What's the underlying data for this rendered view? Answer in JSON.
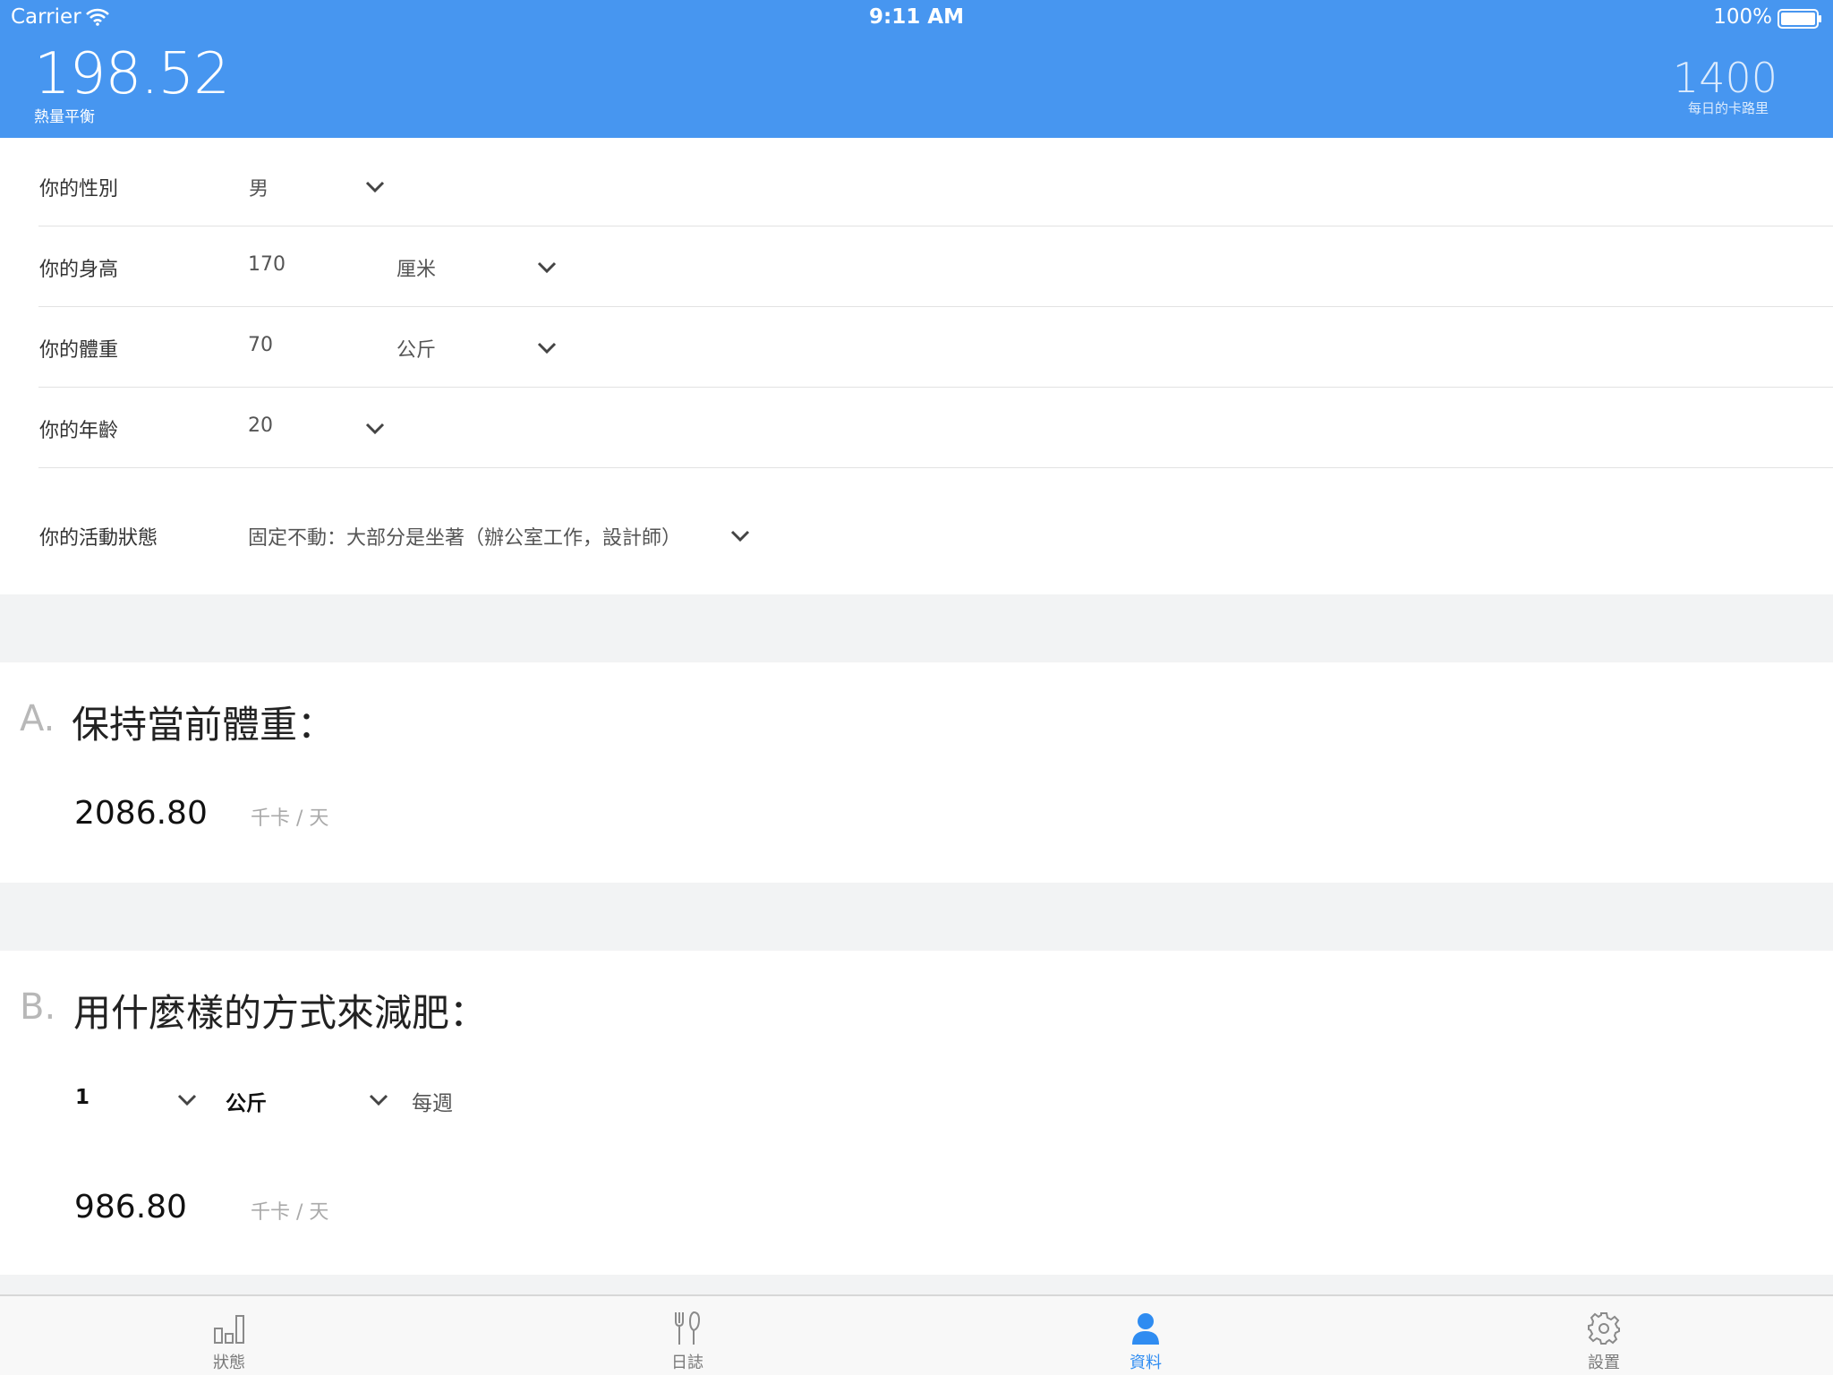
{
  "status_bar": {
    "carrier": "Carrier",
    "time": "9:11 AM",
    "battery": "100%"
  },
  "header": {
    "balance_value": "198.52",
    "balance_label": "熱量平衡",
    "daily_value": "1400",
    "daily_label": "每日的卡路里"
  },
  "form": {
    "gender": {
      "label": "你的性別",
      "value": "男"
    },
    "height": {
      "label": "你的身高",
      "value": "170",
      "unit": "厘米"
    },
    "weight": {
      "label": "你的體重",
      "value": "70",
      "unit": "公斤"
    },
    "age": {
      "label": "你的年齡",
      "value": "20"
    },
    "activity": {
      "label": "你的活動狀態",
      "value": "固定不動：大部分是坐著（辦公室工作，設計師）"
    }
  },
  "section_a": {
    "letter": "A.",
    "title": "保持當前體重：",
    "value": "2086.80",
    "unit": "千卡 / 天"
  },
  "section_b": {
    "letter": "B.",
    "title": "用什麼樣的方式來減肥：",
    "amount": "1",
    "amount_unit": "公斤",
    "period": "每週",
    "value": "986.80",
    "unit": "千卡 / 天"
  },
  "tabs": [
    {
      "label": "狀態",
      "icon": "bar-chart-icon",
      "active": false
    },
    {
      "label": "日誌",
      "icon": "fork-knife-icon",
      "active": false
    },
    {
      "label": "資料",
      "icon": "person-icon",
      "active": true
    },
    {
      "label": "設置",
      "icon": "gear-icon",
      "active": false
    }
  ],
  "colors": {
    "header": "#4796f0",
    "accent": "#2f8cf1",
    "band": "#f2f3f4"
  }
}
